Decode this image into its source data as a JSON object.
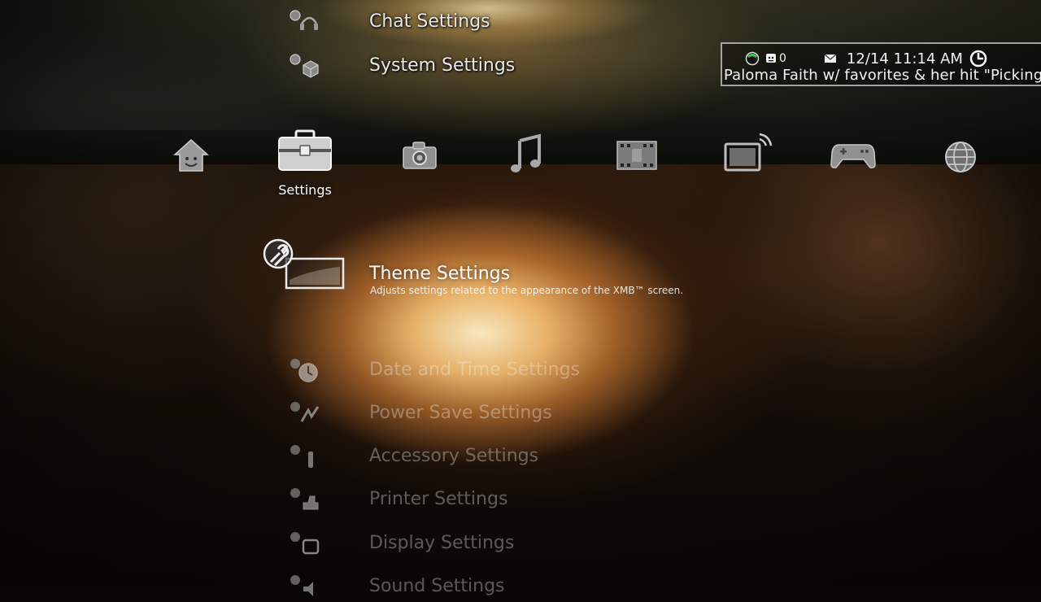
{
  "status": {
    "friends_count": "0",
    "datetime": "12/14 11:14 AM",
    "ticker": "Paloma Faith w/ favorites & her hit \"Picking Up the Pieces\""
  },
  "categories": [
    {
      "id": "users",
      "icon": "home-face-icon"
    },
    {
      "id": "settings",
      "icon": "toolbox-icon",
      "label": "Settings",
      "selected": true
    },
    {
      "id": "photo",
      "icon": "camera-icon"
    },
    {
      "id": "music",
      "icon": "music-note-icon"
    },
    {
      "id": "video",
      "icon": "film-strip-icon"
    },
    {
      "id": "tv",
      "icon": "tv-icon"
    },
    {
      "id": "game",
      "icon": "gamepad-icon"
    },
    {
      "id": "network",
      "icon": "globe-icon"
    }
  ],
  "menu_above": [
    {
      "label": "Chat Settings",
      "icon": "headset-icon"
    },
    {
      "label": "System Settings",
      "icon": "cube-icon"
    }
  ],
  "selected_item": {
    "label": "Theme Settings",
    "description": "Adjusts settings related to the appearance of the XMB™ screen.",
    "icon": "theme-wrench-icon"
  },
  "menu_below": [
    {
      "label": "Date and Time Settings",
      "icon": "clock-icon"
    },
    {
      "label": "Power Save Settings",
      "icon": "power-save-icon"
    },
    {
      "label": "Accessory Settings",
      "icon": "accessory-icon"
    },
    {
      "label": "Printer Settings",
      "icon": "printer-icon"
    },
    {
      "label": "Display Settings",
      "icon": "display-icon"
    },
    {
      "label": "Sound Settings",
      "icon": "sound-icon"
    }
  ]
}
